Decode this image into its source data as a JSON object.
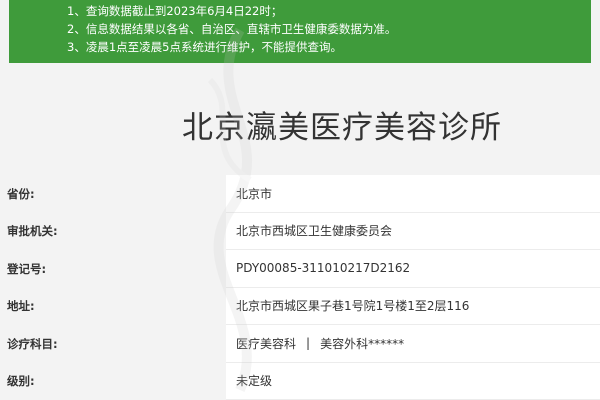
{
  "notice": {
    "lines": [
      "1、查询数据截止到2023年6月4日22时；",
      "2、信息数据结果以各省、自治区、直辖市卫生健康委数据为准。",
      "3、凌晨1点至凌晨5点系统进行维护，不能提供查询。"
    ]
  },
  "title": "北京瀛美医疗美容诊所",
  "fields": [
    {
      "label": "省份:",
      "value": "北京市"
    },
    {
      "label": "审批机关:",
      "value": "北京市西城区卫生健康委员会"
    },
    {
      "label": "登记号:",
      "value": "PDY00085-311010217D2162"
    },
    {
      "label": "地址:",
      "value": "北京市西城区果子巷1号院1号楼1至2层116"
    },
    {
      "label": "诊疗科目:",
      "value_parts": [
        "医疗美容科",
        "|",
        "美容外科******"
      ]
    },
    {
      "label": "级别:",
      "value": "未定级"
    }
  ],
  "colors": {
    "notice_bg": "#3f9b3b",
    "text": "#333333"
  }
}
